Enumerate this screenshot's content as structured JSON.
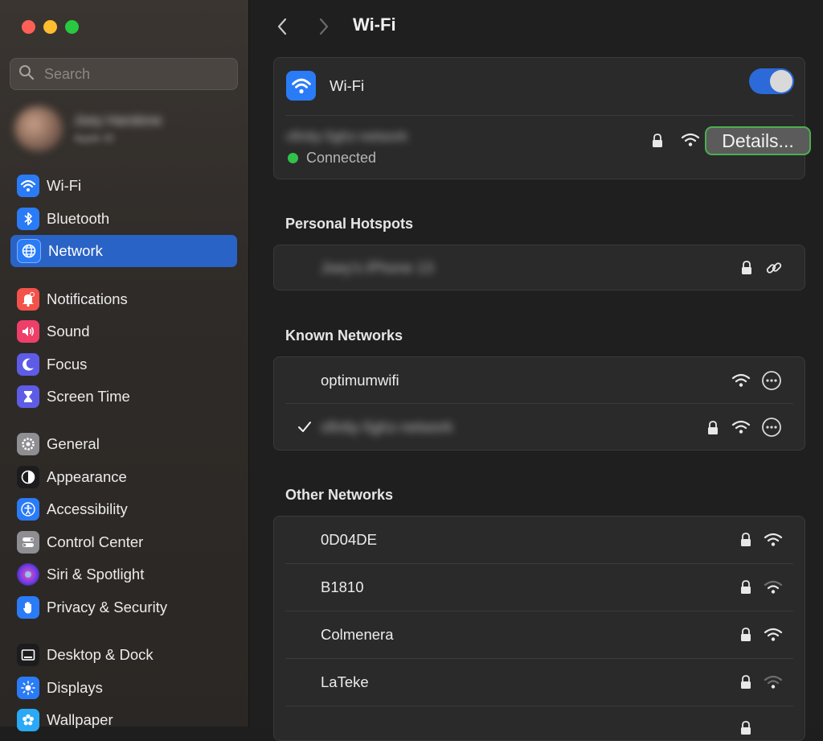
{
  "sidebar": {
    "search_placeholder": "Search",
    "profile": {
      "name": "Joey Handone",
      "subtitle": "Apple ID"
    },
    "items": [
      {
        "label": "Wi-Fi",
        "icon": "wifi-icon",
        "color": "#2a7bf6"
      },
      {
        "label": "Bluetooth",
        "icon": "bluetooth-icon",
        "color": "#2a7bf6"
      },
      {
        "label": "Network",
        "icon": "globe-icon",
        "color": "#2a7bf6",
        "active": true
      },
      {
        "label": "Notifications",
        "icon": "bell-icon",
        "color": "#f2524a"
      },
      {
        "label": "Sound",
        "icon": "speaker-icon",
        "color": "#ee3f69"
      },
      {
        "label": "Focus",
        "icon": "moon-icon",
        "color": "#5e5ce6"
      },
      {
        "label": "Screen Time",
        "icon": "hourglass-icon",
        "color": "#5e5ce6"
      },
      {
        "label": "General",
        "icon": "gear-icon",
        "color": "#8e8e93"
      },
      {
        "label": "Appearance",
        "icon": "appearance-icon",
        "color": "#1c1c1e"
      },
      {
        "label": "Accessibility",
        "icon": "accessibility-icon",
        "color": "#2a7bf6"
      },
      {
        "label": "Control Center",
        "icon": "switches-icon",
        "color": "#8e8e93"
      },
      {
        "label": "Siri & Spotlight",
        "icon": "siri-icon",
        "color": "#7a3cc4"
      },
      {
        "label": "Privacy & Security",
        "icon": "hand-icon",
        "color": "#2a7bf6"
      },
      {
        "label": "Desktop & Dock",
        "icon": "dock-icon",
        "color": "#1c1c1e"
      },
      {
        "label": "Displays",
        "icon": "sun-icon",
        "color": "#2a7bf6"
      },
      {
        "label": "Wallpaper",
        "icon": "flower-icon",
        "color": "#2aa9f6"
      }
    ]
  },
  "toolbar": {
    "title": "Wi-Fi"
  },
  "wifi_card": {
    "label": "Wi-Fi",
    "toggle_on": true,
    "current_network": "xfinity-5ghz-network",
    "status": "Connected",
    "details_button": "Details..."
  },
  "hotspots": {
    "title": "Personal Hotspots",
    "items": [
      {
        "name": "Joey's iPhone 13"
      }
    ]
  },
  "known": {
    "title": "Known Networks",
    "items": [
      {
        "name": "optimumwifi",
        "locked": false,
        "checked": false
      },
      {
        "name": "xfinity-5ghz-network",
        "locked": true,
        "checked": true
      }
    ]
  },
  "other": {
    "title": "Other Networks",
    "items": [
      {
        "name": "0D04DE",
        "signal": "full"
      },
      {
        "name": "B1810",
        "signal": "medium"
      },
      {
        "name": "Colmenera",
        "signal": "full"
      },
      {
        "name": "LaTeke",
        "signal": "weak"
      }
    ]
  },
  "colors": {
    "accent": "#2a63c6",
    "connected": "#31c24b",
    "details_outline": "#4caf50"
  }
}
